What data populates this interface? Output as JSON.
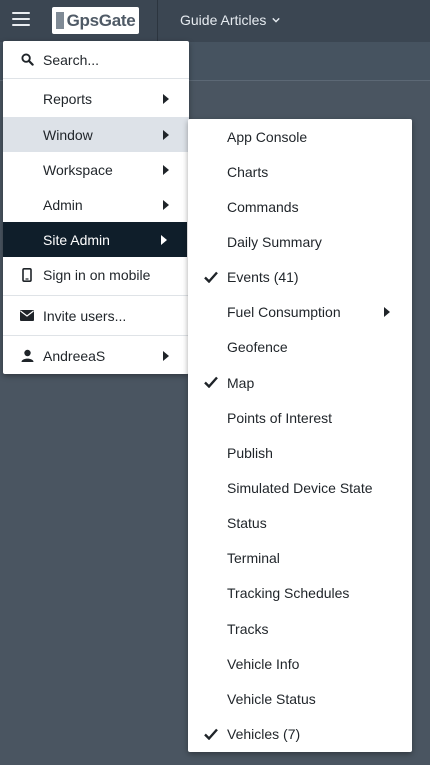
{
  "header": {
    "logo_text": "GpsGate",
    "nav_title": "Guide Articles"
  },
  "main_menu": {
    "search": "Search...",
    "reports": "Reports",
    "window": "Window",
    "workspace": "Workspace",
    "admin": "Admin",
    "site_admin": "Site Admin",
    "sign_in_mobile": "Sign in on mobile",
    "invite_users": "Invite users...",
    "user": "AndreeaS"
  },
  "window_submenu": {
    "items": [
      {
        "label": "App Console",
        "checked": false
      },
      {
        "label": "Charts",
        "checked": false
      },
      {
        "label": "Commands",
        "checked": false
      },
      {
        "label": "Daily Summary",
        "checked": false
      },
      {
        "label": "Events (41)",
        "checked": true
      },
      {
        "label": "Fuel Consumption",
        "checked": false,
        "has_submenu": true
      },
      {
        "label": "Geofence",
        "checked": false
      },
      {
        "label": "Map",
        "checked": true
      },
      {
        "label": "Points of Interest",
        "checked": false
      },
      {
        "label": "Publish",
        "checked": false
      },
      {
        "label": "Simulated Device State",
        "checked": false
      },
      {
        "label": "Status",
        "checked": false
      },
      {
        "label": "Terminal",
        "checked": false
      },
      {
        "label": "Tracking Schedules",
        "checked": false
      },
      {
        "label": "Tracks",
        "checked": false
      },
      {
        "label": "Vehicle Info",
        "checked": false
      },
      {
        "label": "Vehicle Status",
        "checked": false
      },
      {
        "label": "Vehicles (7)",
        "checked": true
      }
    ]
  },
  "colors": {
    "background": "#4a5561",
    "topbar": "#3b4652",
    "active_item": "#0f1e2a",
    "hover_item": "#dde2e8"
  }
}
